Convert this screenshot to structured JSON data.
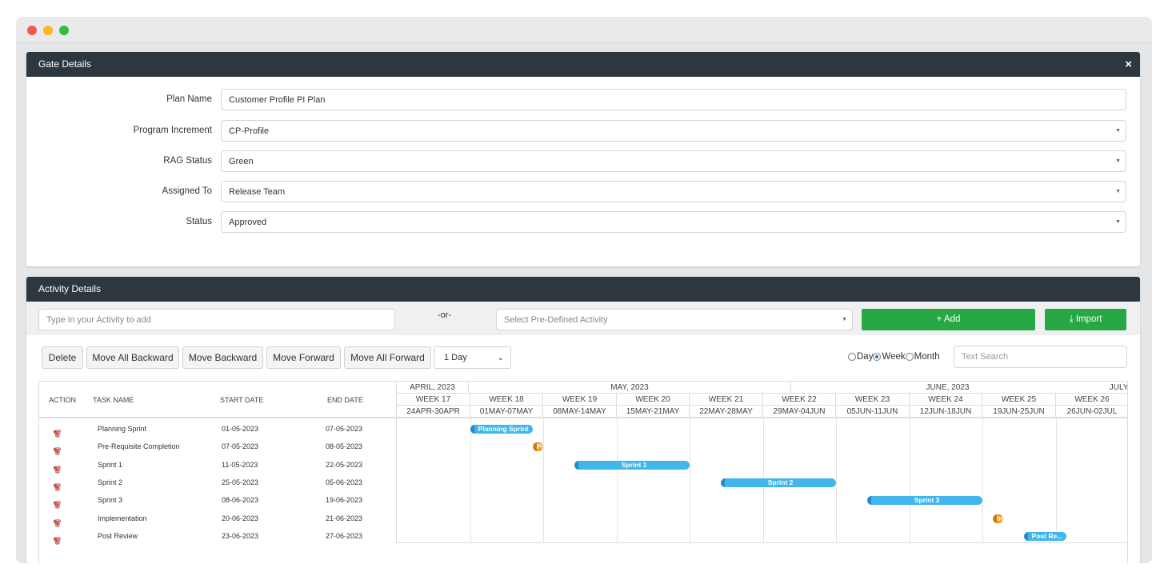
{
  "gate": {
    "title": "Gate Details",
    "close": "×",
    "fields": [
      {
        "label": "Plan Name",
        "value": "Customer Profile PI Plan"
      },
      {
        "label": "Program Increment",
        "value": "CP-Profile"
      },
      {
        "label": "RAG Status",
        "value": "Green"
      },
      {
        "label": "Assigned To",
        "value": "Release Team"
      },
      {
        "label": "Status",
        "value": "Approved"
      }
    ]
  },
  "activity": {
    "title": "Activity Details",
    "input_placeholder": "Type in your Activity to add",
    "or": "-or-",
    "select_placeholder": "Select Pre-Defined Activity",
    "add_label": "+ Add",
    "import_label": "⤓ Import",
    "buttons": [
      "Delete",
      "Move All Backward",
      "Move Backward",
      "Move Forward",
      "Move All Forward"
    ],
    "zoom": "1 Day",
    "views": [
      {
        "label": "Day",
        "checked": false
      },
      {
        "label": "Week",
        "checked": true
      },
      {
        "label": "Month",
        "checked": false
      }
    ],
    "search_placeholder": "Text Search"
  },
  "grid": {
    "headers": {
      "action": "ACTION",
      "task": "TASK NAME",
      "start": "START DATE",
      "end": "END DATE"
    },
    "tasks": [
      {
        "name": "Planning Sprint",
        "start": "01-05-2023",
        "end": "07-05-2023",
        "bar_label": "Planning Sprint",
        "color": "blue"
      },
      {
        "name": "Pre-Requisite Completion",
        "start": "07-05-2023",
        "end": "08-05-2023",
        "bar_label": "Pre",
        "color": "orange"
      },
      {
        "name": "Sprint 1",
        "start": "11-05-2023",
        "end": "22-05-2023",
        "bar_label": "Sprint 1",
        "color": "blue"
      },
      {
        "name": "Sprint 2",
        "start": "25-05-2023",
        "end": "05-06-2023",
        "bar_label": "Sprint 2",
        "color": "blue"
      },
      {
        "name": "Sprint 3",
        "start": "08-06-2023",
        "end": "19-06-2023",
        "bar_label": "Sprint 3",
        "color": "blue"
      },
      {
        "name": "Implementation",
        "start": "20-06-2023",
        "end": "21-06-2023",
        "bar_label": "Im",
        "color": "orange"
      },
      {
        "name": "Post Review",
        "start": "23-06-2023",
        "end": "27-06-2023",
        "bar_label": "Post Re...",
        "color": "blue"
      }
    ]
  },
  "timeline": {
    "months": [
      "APRIL, 2023",
      "MAY, 2023",
      "JUNE, 2023",
      "JULY,"
    ],
    "weeks": [
      {
        "week": "WEEK 17",
        "range": "24APR-30APR"
      },
      {
        "week": "WEEK 18",
        "range": "01MAY-07MAY"
      },
      {
        "week": "WEEK 19",
        "range": "08MAY-14MAY"
      },
      {
        "week": "WEEK 20",
        "range": "15MAY-21MAY"
      },
      {
        "week": "WEEK 21",
        "range": "22MAY-28MAY"
      },
      {
        "week": "WEEK 22",
        "range": "29MAY-04JUN"
      },
      {
        "week": "WEEK 23",
        "range": "05JUN-11JUN"
      },
      {
        "week": "WEEK 24",
        "range": "12JUN-18JUN"
      },
      {
        "week": "WEEK 25",
        "range": "19JUN-25JUN"
      },
      {
        "week": "WEEK 26",
        "range": "26JUN-02JUL"
      }
    ]
  },
  "colors": {
    "header": "#2c373f",
    "green": "#28a745",
    "bar_blue": "#3fb6ec",
    "bar_orange": "#f0a020"
  }
}
